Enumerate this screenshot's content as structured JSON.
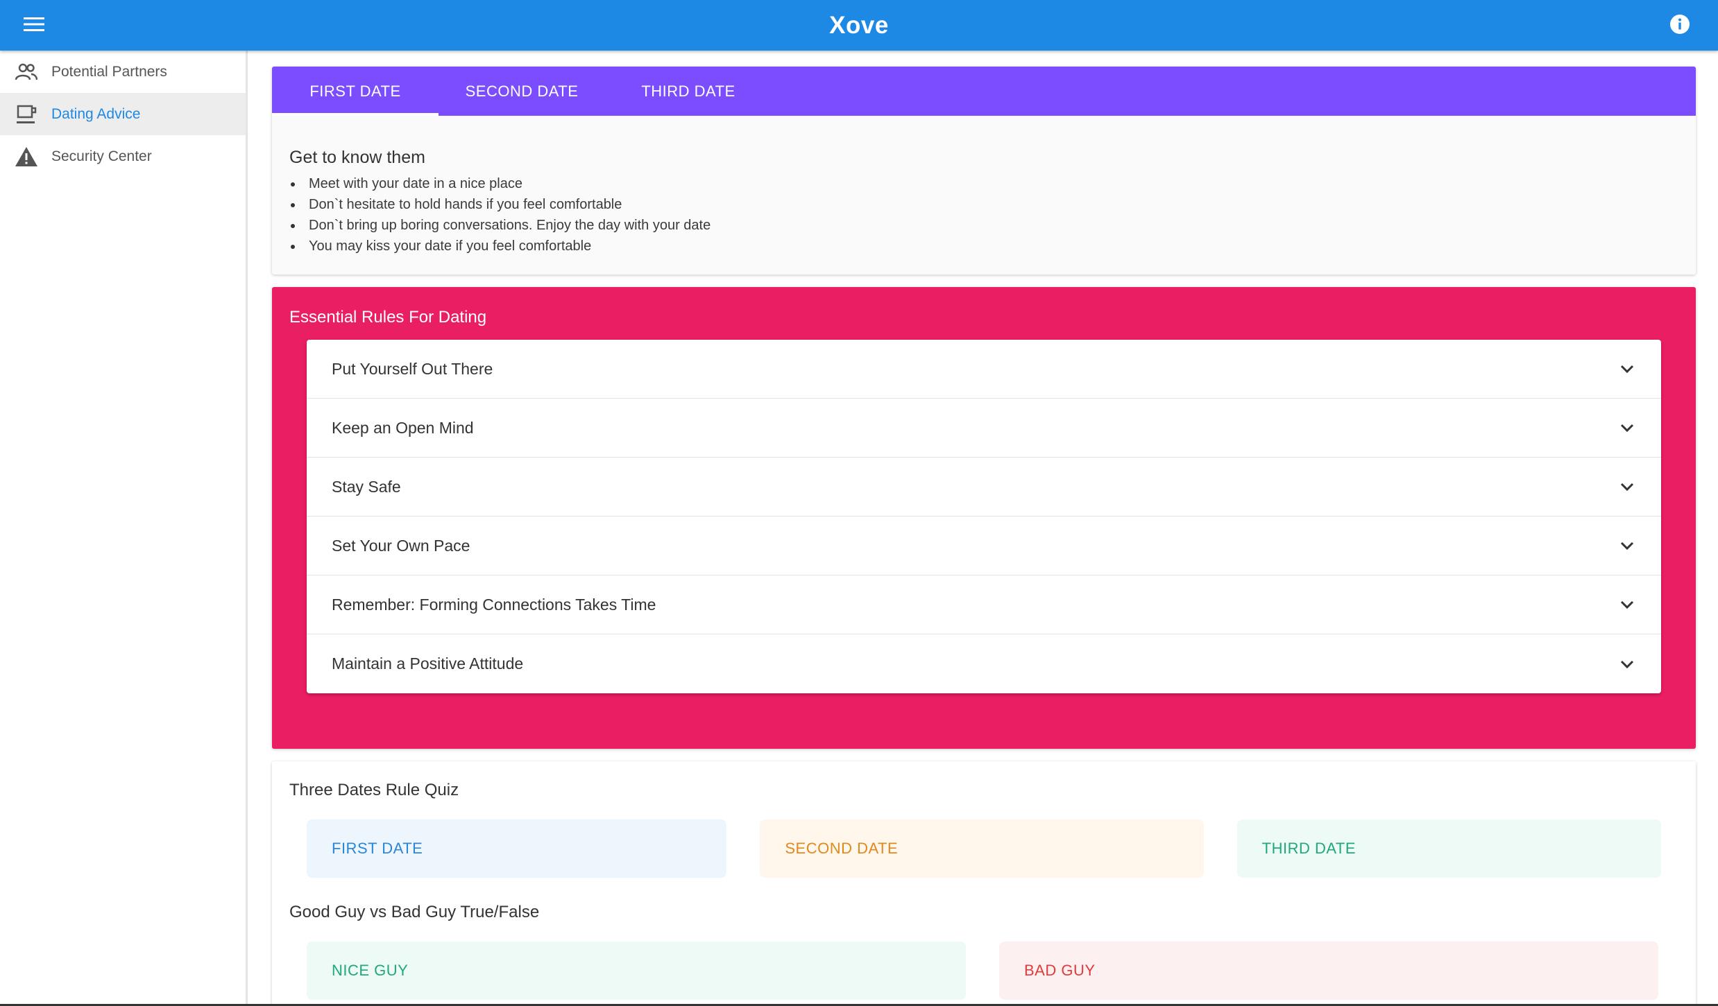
{
  "app": {
    "title": "Xove",
    "colors": {
      "appbar": "#1e88e5",
      "tabs": "#7c4dff",
      "rules": "#e91e63"
    },
    "icons": {
      "menu": "menu-icon",
      "info": "info-icon"
    }
  },
  "sidebar": {
    "items": [
      {
        "label": "Potential Partners",
        "icon": "people-icon",
        "active": false
      },
      {
        "label": "Dating Advice",
        "icon": "coffee-cup-icon",
        "active": true
      },
      {
        "label": "Security Center",
        "icon": "warning-icon",
        "active": false
      }
    ]
  },
  "tabs": {
    "items": [
      {
        "label": "FIRST DATE",
        "active": true
      },
      {
        "label": "SECOND DATE",
        "active": false
      },
      {
        "label": "THIRD DATE",
        "active": false
      }
    ],
    "content": {
      "heading": "Get to know them",
      "bullets": [
        "Meet with your date in a nice place",
        "Don`t hesitate to hold hands if you feel comfortable",
        "Don`t bring up boring conversations. Enjoy the day with your date",
        "You may kiss your date if you feel comfortable"
      ]
    }
  },
  "rules": {
    "title": "Essential Rules For Dating",
    "items": [
      "Put Yourself Out There",
      "Keep an Open Mind",
      "Stay Safe",
      "Set Your Own Pace",
      "Remember: Forming Connections Takes Time",
      "Maintain a Positive Attitude"
    ]
  },
  "quiz": {
    "title": "Three Dates Rule Quiz",
    "dates": [
      "FIRST DATE",
      "SECOND DATE",
      "THIRD DATE"
    ],
    "title2": "Good Guy vs Bad Guy True/False",
    "guys": [
      "NICE GUY",
      "BAD GUY"
    ]
  }
}
